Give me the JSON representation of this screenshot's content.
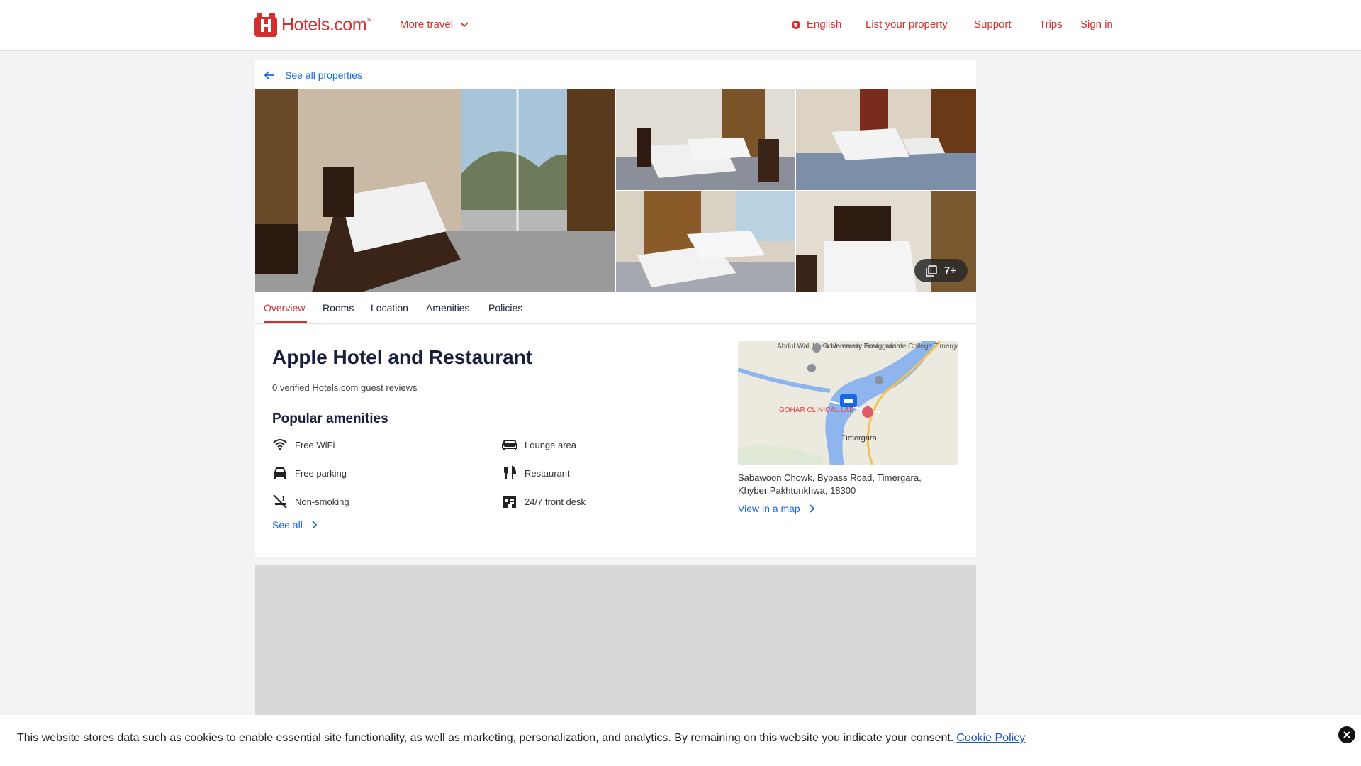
{
  "header": {
    "logo_text": "Hotels.com",
    "logo_tm": "™",
    "more_travel": "More travel",
    "language": "English",
    "list_property": "List your property",
    "support": "Support",
    "trips": "Trips",
    "sign_in": "Sign in"
  },
  "nav": {
    "back_label": "See all properties"
  },
  "gallery": {
    "more_count": "7+"
  },
  "tabs": [
    "Overview",
    "Rooms",
    "Location",
    "Amenities",
    "Policies"
  ],
  "property": {
    "name": "Apple Hotel and Restaurant",
    "reviews": "0 verified Hotels.com guest reviews",
    "amenities_heading": "Popular amenities",
    "amenities": [
      {
        "label": "Free WiFi",
        "icon": "wifi-icon"
      },
      {
        "label": "Lounge area",
        "icon": "sofa-icon"
      },
      {
        "label": "Free parking",
        "icon": "car-icon"
      },
      {
        "label": "Restaurant",
        "icon": "fork-knife-icon"
      },
      {
        "label": "Non-smoking",
        "icon": "no-smoking-icon"
      },
      {
        "label": "24/7 front desk",
        "icon": "front-desk-icon"
      }
    ],
    "see_all": "See all",
    "address_line1": "Sabawoon Chowk, Bypass Road, Timergara,",
    "address_line2": "Khyber Pakhtunkhwa, 18300",
    "view_map": "View in a map"
  },
  "map": {
    "labels": {
      "university": "Abdul Wali Khan University Timergara",
      "college": "Government Postgraduate College Timergara",
      "clinic": "GOHAR CLINICAL LAB",
      "town": "Timergara"
    }
  },
  "cookie": {
    "text": "This website stores data such as cookies to enable essential site functionality, as well as marketing, personalization, and analytics. By remaining on this website you indicate your consent.",
    "link": "Cookie Policy"
  },
  "colors": {
    "brand": "#d32f2f",
    "link": "#1668e3",
    "page_bg": "#f3f3f5"
  }
}
